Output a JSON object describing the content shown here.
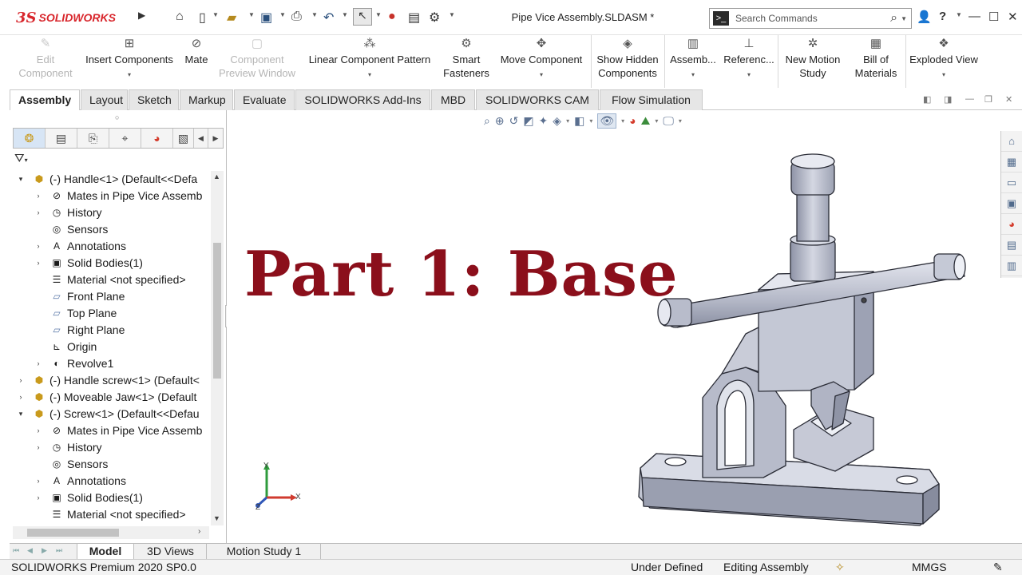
{
  "app": {
    "logo": {
      "ds": "3S",
      "word": "SOLIDWORKS"
    },
    "document_title": "Pipe Vice Assembly.SLDASM *",
    "search_placeholder": "Search Commands",
    "help_label": "?"
  },
  "command_manager": {
    "items": [
      {
        "label": "Edit Component",
        "enabled": false,
        "icon": "edit-component-icon"
      },
      {
        "label": "Insert Components",
        "enabled": true,
        "icon": "insert-components-icon"
      },
      {
        "label": "Mate",
        "enabled": true,
        "icon": "mate-icon"
      },
      {
        "label": "Component Preview Window",
        "enabled": false,
        "icon": "component-preview-icon"
      },
      {
        "label": "Linear Component Pattern",
        "enabled": true,
        "icon": "linear-pattern-icon"
      },
      {
        "label": "Smart Fasteners",
        "enabled": true,
        "icon": "smart-fasteners-icon"
      },
      {
        "label": "Move Component",
        "enabled": true,
        "icon": "move-component-icon"
      },
      {
        "label": "Show Hidden Components",
        "enabled": true,
        "icon": "show-hidden-icon"
      },
      {
        "label": "Assemb...",
        "enabled": true,
        "icon": "assembly-features-icon"
      },
      {
        "label": "Referenc...",
        "enabled": true,
        "icon": "reference-geometry-icon"
      },
      {
        "label": "New Motion Study",
        "enabled": true,
        "icon": "motion-study-icon"
      },
      {
        "label": "Bill of Materials",
        "enabled": true,
        "icon": "bom-icon"
      },
      {
        "label": "Exploded View",
        "enabled": true,
        "icon": "exploded-view-icon"
      }
    ]
  },
  "tabs": [
    {
      "label": "Assembly",
      "active": true
    },
    {
      "label": "Layout"
    },
    {
      "label": "Sketch"
    },
    {
      "label": "Markup"
    },
    {
      "label": "Evaluate"
    },
    {
      "label": "SOLIDWORKS Add-Ins"
    },
    {
      "label": "MBD"
    },
    {
      "label": "SOLIDWORKS CAM"
    },
    {
      "label": "Flow Simulation"
    }
  ],
  "feature_tree": {
    "rows": [
      {
        "label": "(-) Handle<1> (Default<<Defa",
        "icon": "component-icon",
        "expander": "expanded",
        "level": 0
      },
      {
        "label": "Mates in Pipe Vice Assemb",
        "icon": "mates-folder-icon",
        "expander": "collapsed",
        "level": 1
      },
      {
        "label": "History",
        "icon": "history-icon",
        "expander": "collapsed",
        "level": 1
      },
      {
        "label": "Sensors",
        "icon": "sensors-icon",
        "expander": "none",
        "level": 1
      },
      {
        "label": "Annotations",
        "icon": "annotations-icon",
        "expander": "collapsed",
        "level": 1
      },
      {
        "label": "Solid Bodies(1)",
        "icon": "solid-bodies-icon",
        "expander": "collapsed",
        "level": 1
      },
      {
        "label": "Material <not specified>",
        "icon": "material-icon",
        "expander": "none",
        "level": 1
      },
      {
        "label": "Front Plane",
        "icon": "plane-icon",
        "expander": "none",
        "level": 1
      },
      {
        "label": "Top Plane",
        "icon": "plane-icon",
        "expander": "none",
        "level": 1
      },
      {
        "label": "Right Plane",
        "icon": "plane-icon",
        "expander": "none",
        "level": 1
      },
      {
        "label": "Origin",
        "icon": "origin-icon",
        "expander": "none",
        "level": 1
      },
      {
        "label": "Revolve1",
        "icon": "revolve-icon",
        "expander": "collapsed",
        "level": 1
      },
      {
        "label": "(-) Handle screw<1> (Default<",
        "icon": "component-icon",
        "expander": "collapsed",
        "level": 0
      },
      {
        "label": "(-) Moveable Jaw<1> (Default",
        "icon": "component-icon",
        "expander": "collapsed",
        "level": 0
      },
      {
        "label": "(-) Screw<1> (Default<<Defau",
        "icon": "component-icon",
        "expander": "expanded",
        "level": 0
      },
      {
        "label": "Mates in Pipe Vice Assemb",
        "icon": "mates-folder-icon",
        "expander": "collapsed",
        "level": 1
      },
      {
        "label": "History",
        "icon": "history-icon",
        "expander": "collapsed",
        "level": 1
      },
      {
        "label": "Sensors",
        "icon": "sensors-icon",
        "expander": "none",
        "level": 1
      },
      {
        "label": "Annotations",
        "icon": "annotations-icon",
        "expander": "collapsed",
        "level": 1
      },
      {
        "label": "Solid Bodies(1)",
        "icon": "solid-bodies-icon",
        "expander": "collapsed",
        "level": 1
      },
      {
        "label": "Material <not specified>",
        "icon": "material-icon",
        "expander": "none",
        "level": 1
      }
    ]
  },
  "viewport": {
    "headline": "Part 1: Base",
    "headline_color": "#8b0f1b",
    "triad": {
      "x": "X",
      "y": "Y",
      "z": "Z"
    }
  },
  "bottom_tabs": [
    {
      "label": "Model",
      "active": true
    },
    {
      "label": "3D Views"
    },
    {
      "label": "Motion Study 1"
    }
  ],
  "status_bar": {
    "product": "SOLIDWORKS Premium 2020 SP0.0",
    "definition": "Under Defined",
    "mode": "Editing Assembly",
    "units": "MMGS"
  }
}
